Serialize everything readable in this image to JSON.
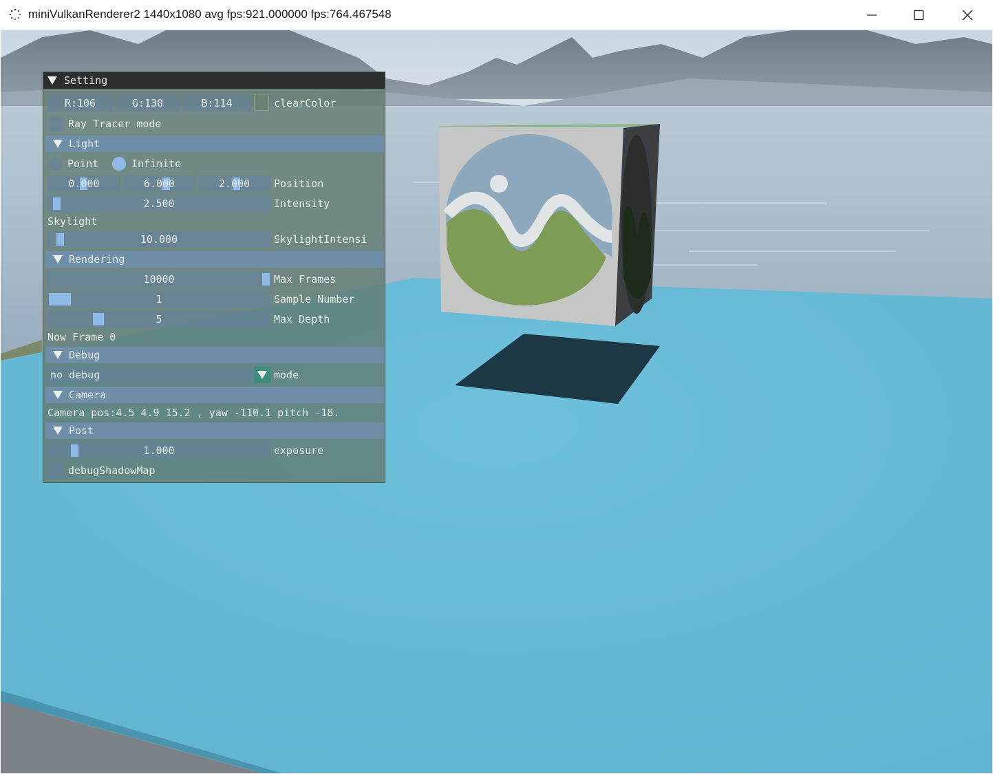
{
  "window": {
    "title": "miniVulkanRenderer2 1440x1080 avg fps:921.000000 fps:764.467548",
    "controls": [
      "minimize-icon",
      "maximize-icon",
      "close-icon"
    ]
  },
  "panel": {
    "title": "Setting",
    "clear_color": {
      "r": "R:106",
      "g": "G:130",
      "b": "B:114",
      "label": "clearColor",
      "swatch": "#6a8272"
    },
    "ray_tracer_label": "Ray Tracer mode",
    "light": {
      "header": "Light",
      "radio_point": "Point",
      "radio_infinite": "Infinite",
      "selected": "Infinite",
      "position": [
        "0.000",
        "6.000",
        "2.000"
      ],
      "position_label": "Position",
      "intensity": "2.500",
      "intensity_label": "Intensity",
      "skylight_title": "Skylight",
      "skylight_intensity": "10.000",
      "skylight_label": "SkylightIntensi"
    },
    "rendering": {
      "header": "Rendering",
      "max_frames": "10000",
      "max_frames_label": "Max Frames",
      "sample_number": "1",
      "sample_number_label": "Sample Number",
      "max_depth": "5",
      "max_depth_label": "Max Depth",
      "now_frame": "Now Frame 0"
    },
    "debug": {
      "header": "Debug",
      "mode_value": "no debug",
      "mode_label": "mode"
    },
    "camera": {
      "header": "Camera",
      "info": "Camera pos:4.5 4.9 15.2 , yaw -110.1 pitch -18."
    },
    "post": {
      "header": "Post",
      "exposure": "1.000",
      "exposure_label": "exposure",
      "debug_shadow_label": "debugShadowMap"
    }
  },
  "colors": {
    "floor": "#66b9d6",
    "panel_header": "#6f8fa8",
    "slider_grab": "#8fbae8",
    "combo_button": "#3b8f7a"
  }
}
